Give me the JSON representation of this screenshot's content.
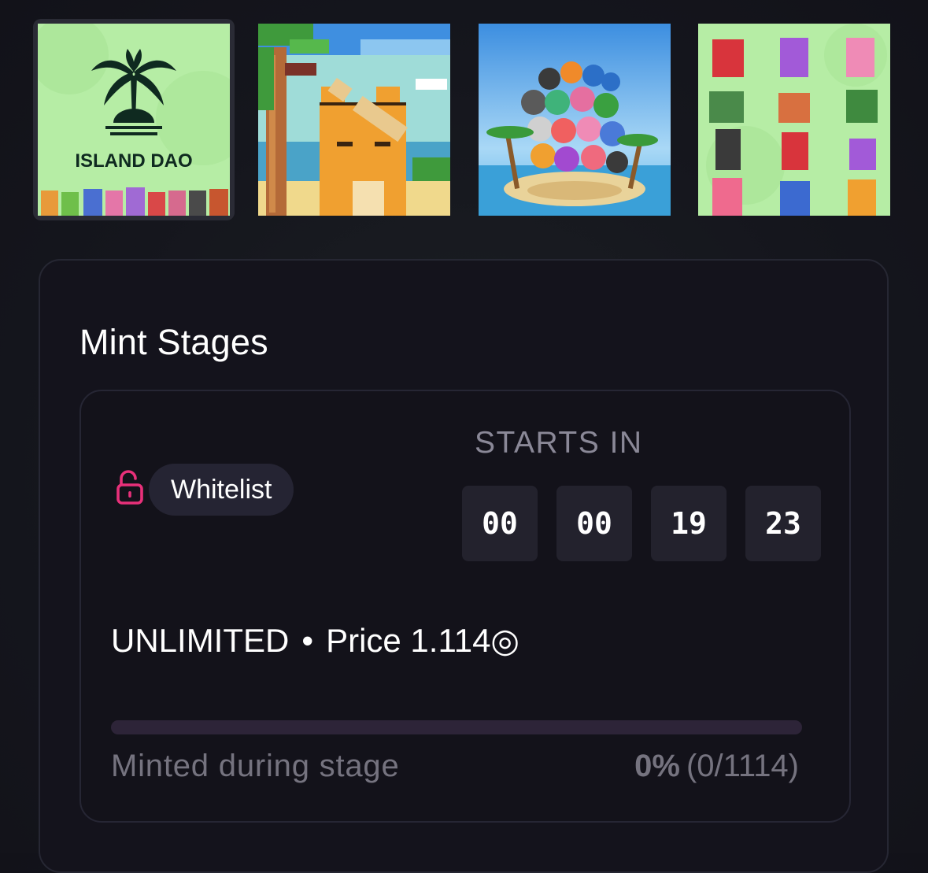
{
  "gallery": {
    "thumbnails": [
      {
        "name": "island-dao-logo",
        "caption": "ISLAND DAO",
        "selected": true
      },
      {
        "name": "pixel-cat-bat",
        "selected": false
      },
      {
        "name": "island-characters",
        "selected": false
      },
      {
        "name": "character-grid",
        "selected": false
      }
    ]
  },
  "mint": {
    "title": "Mint Stages",
    "stage": {
      "name": "Whitelist",
      "lock_icon": "unlocked-padlock-icon",
      "starts_in_label": "STARTS IN",
      "countdown": [
        "00",
        "00",
        "19",
        "23"
      ],
      "supply_label": "UNLIMITED",
      "separator": "•",
      "price_label": "Price 1.114◎",
      "minted_label": "Minted during stage",
      "minted_percent": "0%",
      "minted_count": "(0/1114)",
      "progress": 0
    }
  },
  "colors": {
    "background": "#14151d",
    "card": "#14131c",
    "badge": "#252433",
    "accent_pink": "#e8307a",
    "muted_text": "#75737f",
    "progress_track": "#2d2438"
  }
}
